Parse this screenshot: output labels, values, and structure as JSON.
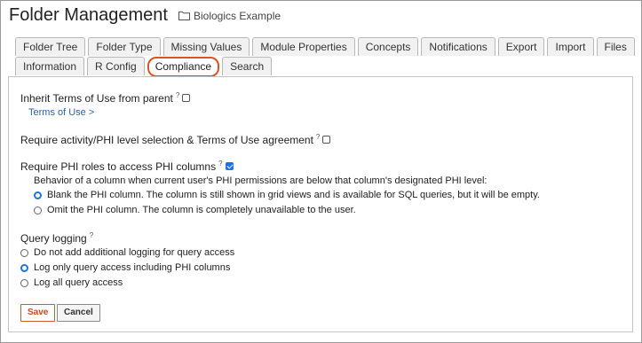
{
  "header": {
    "title": "Folder Management",
    "folder": "Biologics Example"
  },
  "tabs": {
    "row1": [
      "Folder Tree",
      "Folder Type",
      "Missing Values",
      "Module Properties",
      "Concepts",
      "Notifications",
      "Export",
      "Import",
      "Files"
    ],
    "row2": [
      "Information",
      "R Config",
      "Compliance",
      "Search"
    ],
    "active": "Compliance"
  },
  "compliance": {
    "inherit_terms_label": "Inherit Terms of Use from parent",
    "inherit_terms_checked": false,
    "terms_link": "Terms of Use >",
    "require_activity_label": "Require activity/PHI level selection & Terms of Use agreement",
    "require_activity_checked": false,
    "require_phi_label": "Require PHI roles to access PHI columns",
    "require_phi_checked": true,
    "behavior_text": "Behavior of a column when current user's PHI permissions are below that column's designated PHI level:",
    "phi_options": [
      {
        "label": "Blank the PHI column. The column is still shown in grid views and is available for SQL queries, but it will be empty.",
        "selected": true
      },
      {
        "label": "Omit the PHI column. The column is completely unavailable to the user.",
        "selected": false
      }
    ],
    "query_logging_label": "Query logging",
    "logging_options": [
      {
        "label": "Do not add additional logging for query access",
        "selected": false
      },
      {
        "label": "Log only query access including PHI columns",
        "selected": true
      },
      {
        "label": "Log all query access",
        "selected": false
      }
    ],
    "help_marker": "?"
  },
  "buttons": {
    "save": "Save",
    "cancel": "Cancel"
  },
  "colors": {
    "accent": "#d9541e",
    "check": "#1a73e8",
    "link": "#2a62a8"
  }
}
